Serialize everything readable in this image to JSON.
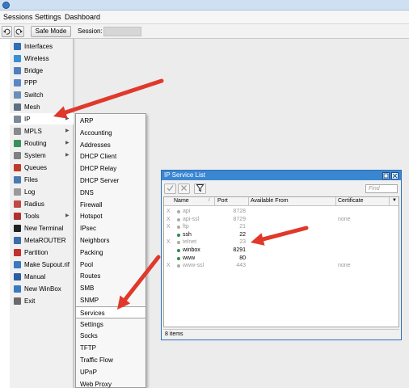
{
  "menubar": {
    "items": [
      "Sessions",
      "Settings",
      "Dashboard"
    ]
  },
  "toolbar": {
    "undo_icon": "undo-icon",
    "redo_icon": "redo-icon",
    "safe_mode": "Safe Mode",
    "session_label": "Session:"
  },
  "sidebar": {
    "items": [
      {
        "label": "Interfaces",
        "color": "#2f6fb5",
        "arrow": false
      },
      {
        "label": "Wireless",
        "color": "#3a8fd6",
        "arrow": false
      },
      {
        "label": "Bridge",
        "color": "#4f7fbf",
        "arrow": false
      },
      {
        "label": "PPP",
        "color": "#5a86c8",
        "arrow": false
      },
      {
        "label": "Switch",
        "color": "#6b8fb8",
        "arrow": false
      },
      {
        "label": "Mesh",
        "color": "#5f6f7f",
        "arrow": false
      },
      {
        "label": "IP",
        "color": "#7a8a9a",
        "arrow": true
      },
      {
        "label": "MPLS",
        "color": "#8a8a8a",
        "arrow": true
      },
      {
        "label": "Routing",
        "color": "#3c8f5c",
        "arrow": true
      },
      {
        "label": "System",
        "color": "#808080",
        "arrow": true
      },
      {
        "label": "Queues",
        "color": "#c0392b",
        "arrow": false
      },
      {
        "label": "Files",
        "color": "#4a7ab0",
        "arrow": false
      },
      {
        "label": "Log",
        "color": "#9a9a9a",
        "arrow": false
      },
      {
        "label": "Radius",
        "color": "#c04848",
        "arrow": false
      },
      {
        "label": "Tools",
        "color": "#b03030",
        "arrow": true
      },
      {
        "label": "New Terminal",
        "color": "#222222",
        "arrow": false
      },
      {
        "label": "MetaROUTER",
        "color": "#3a6ea8",
        "arrow": false
      },
      {
        "label": "Partition",
        "color": "#c03030",
        "arrow": false
      },
      {
        "label": "Make Supout.rif",
        "color": "#3a7ac0",
        "arrow": false
      },
      {
        "label": "Manual",
        "color": "#2a5fa0",
        "arrow": false
      },
      {
        "label": "New WinBox",
        "color": "#3a7ac0",
        "arrow": false
      },
      {
        "label": "Exit",
        "color": "#6a6a6a",
        "arrow": false
      }
    ]
  },
  "submenu": {
    "items": [
      "ARP",
      "Accounting",
      "Addresses",
      "DHCP Client",
      "DHCP Relay",
      "DHCP Server",
      "DNS",
      "Firewall",
      "Hotspot",
      "IPsec",
      "Neighbors",
      "Packing",
      "Pool",
      "Routes",
      "SMB",
      "SNMP",
      "Services",
      "Settings",
      "Socks",
      "TFTP",
      "Traffic Flow",
      "UPnP",
      "Web Proxy"
    ],
    "selected": "Services"
  },
  "service_window": {
    "title": "IP Service List",
    "find_placeholder": "Find",
    "columns": [
      "Name",
      "Port",
      "Available From",
      "Certificate"
    ],
    "rows": [
      {
        "flag": "X",
        "name": "api",
        "port": "8728",
        "from": "",
        "cert": "",
        "disabled": true
      },
      {
        "flag": "X",
        "name": "api-ssl",
        "port": "8729",
        "from": "",
        "cert": "none",
        "disabled": true
      },
      {
        "flag": "X",
        "name": "ftp",
        "port": "21",
        "from": "",
        "cert": "",
        "disabled": true
      },
      {
        "flag": "",
        "name": "ssh",
        "port": "22",
        "from": "",
        "cert": "",
        "disabled": false
      },
      {
        "flag": "X",
        "name": "telnet",
        "port": "23",
        "from": "",
        "cert": "",
        "disabled": true
      },
      {
        "flag": "",
        "name": "winbox",
        "port": "8291",
        "from": "",
        "cert": "",
        "disabled": false
      },
      {
        "flag": "",
        "name": "www",
        "port": "80",
        "from": "",
        "cert": "",
        "disabled": false
      },
      {
        "flag": "X",
        "name": "www-ssl",
        "port": "443",
        "from": "",
        "cert": "none",
        "disabled": true
      }
    ],
    "status": "8 items"
  },
  "annotation_color": "#e0392b"
}
